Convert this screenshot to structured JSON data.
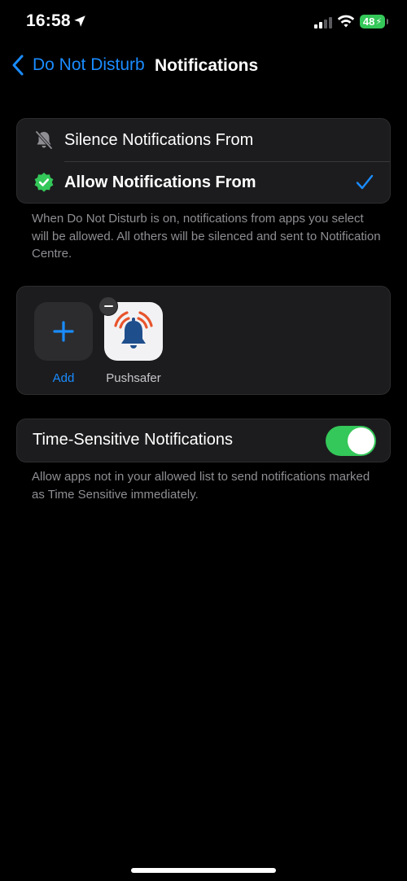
{
  "status_bar": {
    "time": "16:58",
    "battery_percent": "48",
    "location-icon": "location-arrow-icon",
    "icons": [
      "signal-icon",
      "wifi-icon",
      "battery-icon"
    ]
  },
  "nav": {
    "back_label": "Do Not Disturb",
    "title": "Notifications"
  },
  "notification_mode": {
    "options": [
      {
        "label": "Silence Notifications From",
        "icon": "bell-slash-icon",
        "selected": false
      },
      {
        "label": "Allow Notifications From",
        "icon": "verified-badge-icon",
        "selected": true
      }
    ],
    "footnote": "When Do Not Disturb is on, notifications from apps you select will be allowed. All others will be silenced and sent to Notification Centre."
  },
  "allowed_apps": {
    "add_label": "Add",
    "apps": [
      {
        "name": "Pushsafer",
        "icon": "pushsafer-bell-icon"
      }
    ]
  },
  "time_sensitive": {
    "label": "Time-Sensitive Notifications",
    "enabled": true,
    "footnote": "Allow apps not in your allowed list to send notifications marked as Time Sensitive immediately."
  },
  "colors": {
    "accent": "#1a8cff",
    "toggle_on": "#34c759",
    "cell_bg": "#1c1c1e",
    "secondary_text": "#8e8e93"
  }
}
